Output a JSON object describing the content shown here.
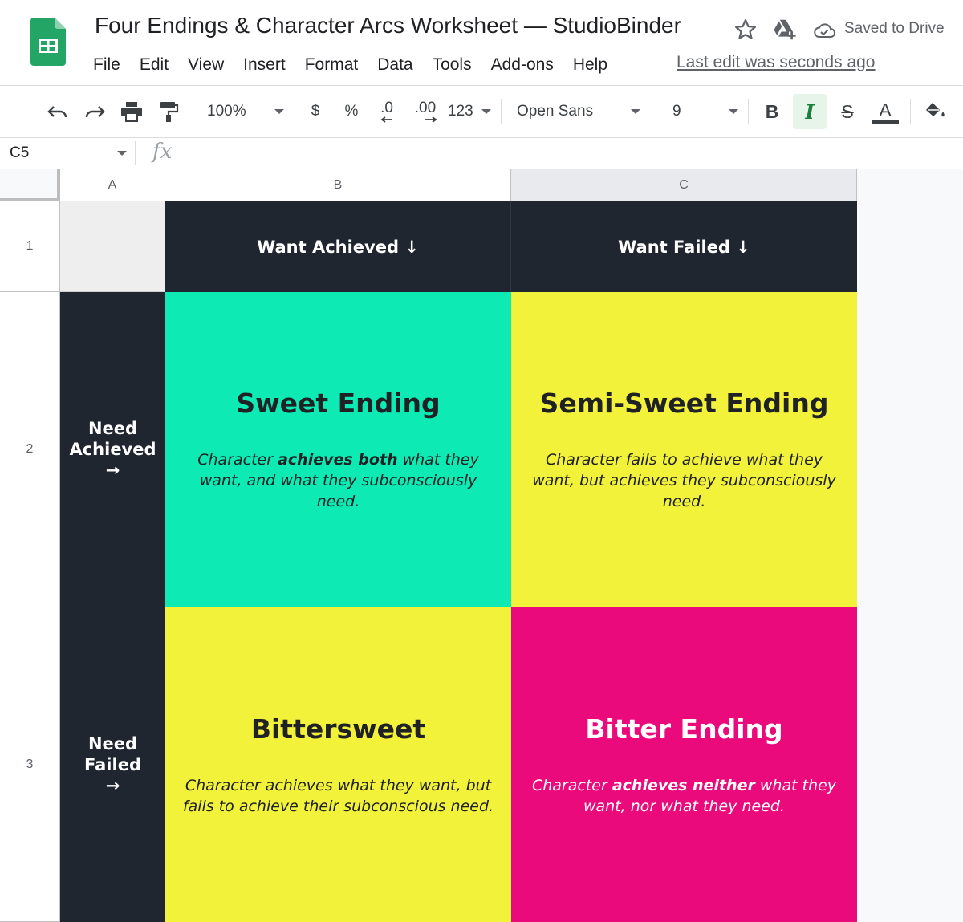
{
  "app": {
    "doc_title": "Four Endings & Character Arcs Worksheet — StudioBinder",
    "saved_status": "Saved to Drive",
    "last_edit": "Last edit was seconds ago",
    "menu": [
      "File",
      "Edit",
      "View",
      "Insert",
      "Format",
      "Data",
      "Tools",
      "Add-ons",
      "Help"
    ]
  },
  "toolbar": {
    "zoom": "100%",
    "currency": "$",
    "percent": "%",
    "decrease_decimal": ".0",
    "increase_decimal": ".00",
    "more_formats": "123",
    "font_name": "Open Sans",
    "font_size": "9",
    "bold": "B",
    "italic": "I",
    "strikethrough": "S",
    "text_color": "A",
    "text_color_bar": "#3c4043",
    "italic_active_bg": "#e6f4ea"
  },
  "formula_bar": {
    "name_box": "C5",
    "fx": "fx",
    "value": ""
  },
  "grid": {
    "columns": [
      "A",
      "B",
      "C"
    ],
    "rows": [
      "1",
      "2",
      "3"
    ],
    "header_row": {
      "b": "Want Achieved ↓",
      "c": "Want Failed ↓"
    },
    "row_labels": {
      "need_achieved": {
        "line1": "Need",
        "line2": "Achieved",
        "arrow": "→"
      },
      "need_failed": {
        "line1": "Need",
        "line2": "Failed",
        "arrow": "→"
      }
    },
    "quadrants": {
      "sweet": {
        "title": "Sweet Ending",
        "desc_pre": "Character ",
        "desc_bold": "achieves both",
        "desc_post": " what they want, and what they subconsciously need.",
        "bg": "#0deab4"
      },
      "semi_sweet": {
        "title": "Semi-Sweet Ending",
        "desc": "Character fails to achieve what they want, but achieves they subconsciously need.",
        "bg": "#f2f23a"
      },
      "bittersweet": {
        "title": "Bittersweet",
        "desc": "Character achieves what they want, but fails to achieve their subconscious need.",
        "bg": "#f2f23a"
      },
      "bitter": {
        "title": "Bitter Ending",
        "desc_pre": "Character ",
        "desc_bold": "achieves neither",
        "desc_post": " what they want, nor what they need.",
        "bg": "#ea0a7c"
      }
    },
    "dark_bg": "#1f2630"
  }
}
